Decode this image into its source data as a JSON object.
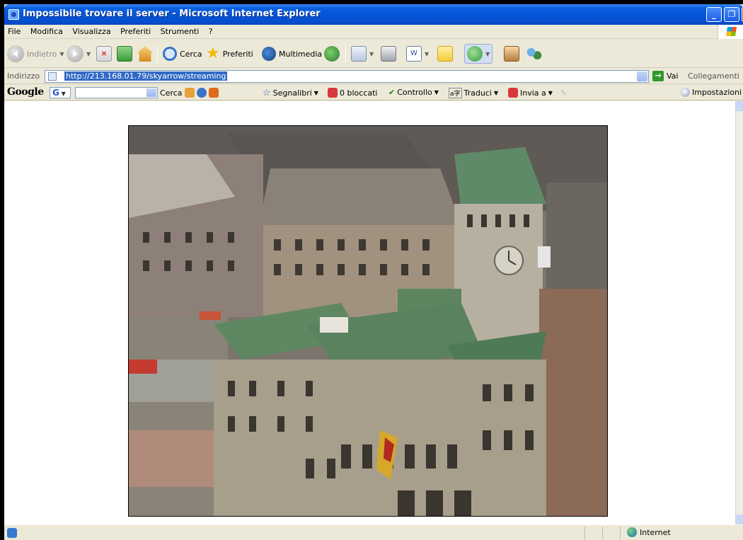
{
  "window": {
    "title": "Impossibile trovare il server - Microsoft Internet Explorer",
    "controls": [
      "minimize",
      "maximize",
      "close"
    ]
  },
  "menu": [
    "File",
    "Modifica",
    "Visualizza",
    "Preferiti",
    "Strumenti",
    "?"
  ],
  "toolbar": {
    "back": "Indietro",
    "search": "Cerca",
    "favorites": "Preferiti",
    "media": "Multimedia"
  },
  "address": {
    "label": "Indirizzo",
    "url": "http://213.168.01.79/skyarrow/streaming",
    "go": "Vai",
    "links": "Collegamenti"
  },
  "google": {
    "logo": "Google",
    "g_button": "G",
    "search": "Cerca",
    "bookmarks": "Segnalibri",
    "blocked": "0 bloccati",
    "check": "Controllo",
    "translate": "Traduci",
    "send": "Invia a",
    "settings": "Impostazioni"
  },
  "status": {
    "zone": "Internet"
  },
  "icons": {
    "back": "arrow-left-icon",
    "forward": "arrow-right-icon",
    "stop": "stop-icon",
    "refresh": "refresh-icon",
    "home": "home-icon",
    "search": "magnifier-icon",
    "favorites": "star-icon",
    "media": "media-icon",
    "history": "history-icon",
    "mail": "mail-icon",
    "print": "printer-icon",
    "edit": "word-icon",
    "folder": "folder-icon",
    "messenger": "messenger-icon",
    "research": "research-icon",
    "people": "people-icon"
  },
  "colors": {
    "titlebar": "#0a5fe0",
    "chrome": "#ece9d8",
    "selection": "#316ac5"
  }
}
